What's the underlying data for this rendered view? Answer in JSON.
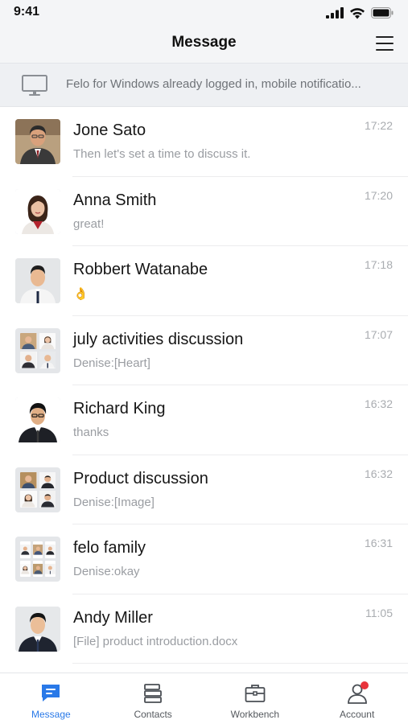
{
  "status_bar": {
    "time": "9:41"
  },
  "header": {
    "title": "Message"
  },
  "notice": {
    "text": "Felo for Windows already logged in, mobile notificatio..."
  },
  "conversations": [
    {
      "name": "Jone Sato",
      "preview": "Then let's set a time to discuss it.",
      "time": "17:22",
      "avatar": "person-photo"
    },
    {
      "name": "Anna Smith",
      "preview": "great!",
      "time": "17:20",
      "avatar": "person-photo"
    },
    {
      "name": "Robbert Watanabe",
      "preview": "👌",
      "time": "17:18",
      "avatar": "person-photo"
    },
    {
      "name": "july activities discussion",
      "preview": "Denise:[Heart]",
      "time": "17:07",
      "avatar": "group-photo"
    },
    {
      "name": "Richard King",
      "preview": "thanks",
      "time": "16:32",
      "avatar": "person-photo"
    },
    {
      "name": "Product discussion",
      "preview": "Denise:[Image]",
      "time": "16:32",
      "avatar": "group-photo"
    },
    {
      "name": "felo family",
      "preview": "Denise:okay",
      "time": "16:31",
      "avatar": "group-photo"
    },
    {
      "name": "Andy Miller",
      "preview": "[File] product introduction.docx",
      "time": "11:05",
      "avatar": "person-photo"
    }
  ],
  "tabs": [
    {
      "label": "Message",
      "icon": "message-icon",
      "active": true
    },
    {
      "label": "Contacts",
      "icon": "contacts-icon",
      "active": false
    },
    {
      "label": "Workbench",
      "icon": "workbench-icon",
      "active": false
    },
    {
      "label": "Account",
      "icon": "account-icon",
      "active": false,
      "badge": true
    }
  ],
  "colors": {
    "accent": "#2979e8",
    "badge": "#e8333b",
    "header_bg": "#f4f5f7",
    "notice_bg": "#eef0f3"
  }
}
